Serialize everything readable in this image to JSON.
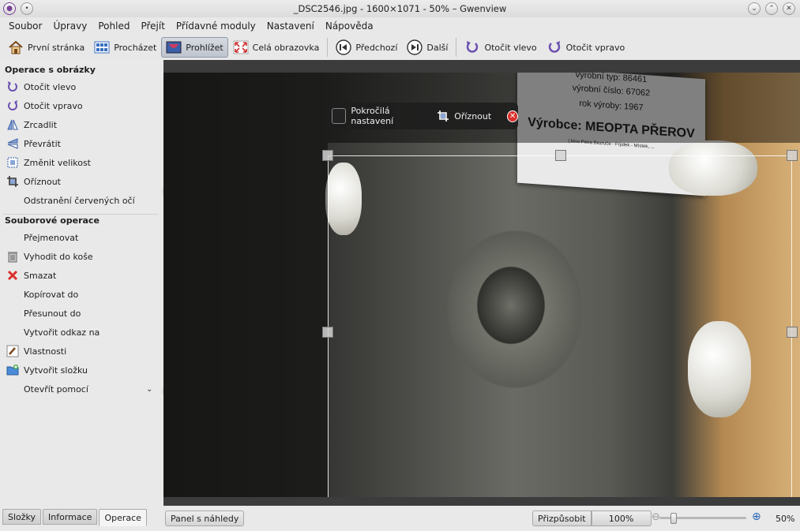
{
  "window": {
    "title": "_DSC2546.jpg - 1600×1071 - 50% – Gwenview"
  },
  "menu": [
    "Soubor",
    "Úpravy",
    "Pohled",
    "Přejít",
    "Přídavné moduly",
    "Nastavení",
    "Nápověda"
  ],
  "toolbar": {
    "home": "První stránka",
    "browse": "Procházet",
    "view": "Prohlížet",
    "fullscreen": "Celá obrazovka",
    "previous": "Předchozí",
    "next": "Další",
    "rotate_left": "Otočit vlevo",
    "rotate_right": "Otočit vpravo"
  },
  "sidebar": {
    "image_ops_title": "Operace s obrázky",
    "image_ops": [
      "Otočit vlevo",
      "Otočit vpravo",
      "Zrcadlit",
      "Převrátit",
      "Změnit velikost",
      "Oříznout",
      "Odstranění červených očí"
    ],
    "file_ops_title": "Souborové operace",
    "file_ops": [
      "Přejmenovat",
      "Vyhodit do koše",
      "Smazat",
      "Kopírovat do",
      "Přesunout do",
      "Vytvořit odkaz na",
      "Vlastnosti",
      "Vytvořit složku",
      "Otevřít pomocí"
    ]
  },
  "bottom_tabs": [
    "Složky",
    "Informace",
    "Operace"
  ],
  "crop_toolbar": {
    "advanced": "Pokročilá nastavení",
    "crop": "Oříznout"
  },
  "photo_label": {
    "line1": "výrobní typ: 86461",
    "line2": "výrobní číslo: 67062",
    "line3": "rok výroby: 1967",
    "maker": "Výrobce: MEOPTA PŘEROV",
    "small": "( kino Petra Bezruče - Frýdek - Místek, ..."
  },
  "statusbar": {
    "thumbnails": "Panel s náhledy",
    "fit": "Přizpůsobit",
    "zoom100": "100%",
    "zoom": "50%"
  },
  "colors": {
    "accent": "#2a64b8",
    "delete": "#d9302c"
  }
}
